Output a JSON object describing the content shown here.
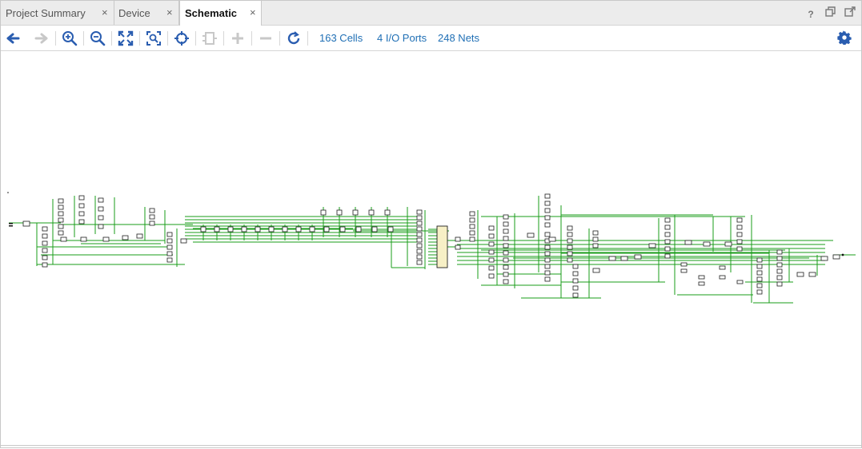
{
  "tabs": [
    {
      "label": "Project Summary",
      "close": "×"
    },
    {
      "label": "Device",
      "close": "×"
    },
    {
      "label": "Schematic",
      "close": "×"
    }
  ],
  "window_icons": [
    "help-icon",
    "restore-icon",
    "float-icon"
  ],
  "toolbar": {
    "buttons": [
      "back-arrow-icon",
      "forward-arrow-icon",
      "zoom-in-icon",
      "zoom-out-icon",
      "zoom-fit-icon",
      "zoom-area-icon",
      "center-icon",
      "expand-cell-icon",
      "add-icon",
      "remove-icon",
      "refresh-icon"
    ],
    "stats": {
      "cells": "163 Cells",
      "ports": "4 I/O Ports",
      "nets": "248 Nets"
    }
  },
  "colors": {
    "wire": "#1a9c1a",
    "cell_border": "#1f1f1f",
    "link": "#1f6fb5",
    "accent_blue": "#2a5db0",
    "disabled": "#c8c8c8"
  }
}
